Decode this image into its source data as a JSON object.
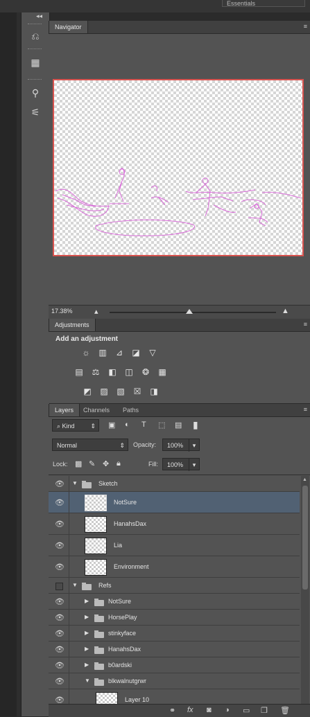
{
  "workspace": {
    "label": "Essentials"
  },
  "tools": {
    "history_icon": "history-icon",
    "properties_icon": "3d-icon",
    "brush_icon": "brush-presets-icon",
    "adjust_icon": "adjustments-tool-icon"
  },
  "navigator": {
    "tab": "Navigator",
    "zoom": "17.38%",
    "zoom_slider_fraction": 0.48
  },
  "adjustments": {
    "tab": "Adjustments",
    "title": "Add an adjustment"
  },
  "layers": {
    "tabs": [
      "Layers",
      "Channels",
      "Paths"
    ],
    "filter_kind": "Kind",
    "blend_mode": "Normal",
    "opacity_label": "Opacity:",
    "opacity_value": "100%",
    "lock_label": "Lock:",
    "fill_label": "Fill:",
    "fill_value": "100%",
    "rows": [
      {
        "name": "Sketch",
        "type": "group",
        "visible": true,
        "expanded": true,
        "indent": 0
      },
      {
        "name": "NotSure",
        "type": "layer",
        "visible": true,
        "selected": true,
        "indent": 1
      },
      {
        "name": "HanahsDax",
        "type": "layer",
        "visible": true,
        "indent": 1
      },
      {
        "name": "Lia",
        "type": "layer",
        "visible": true,
        "indent": 1
      },
      {
        "name": "Environment",
        "type": "layer",
        "visible": true,
        "indent": 1
      },
      {
        "name": "Refs",
        "type": "group",
        "visible": false,
        "expanded": true,
        "indent": 0
      },
      {
        "name": "NotSure",
        "type": "group",
        "visible": true,
        "expanded": false,
        "indent": 1
      },
      {
        "name": "HorsePlay",
        "type": "group",
        "visible": true,
        "expanded": false,
        "indent": 1
      },
      {
        "name": "stinkyface",
        "type": "group",
        "visible": true,
        "expanded": false,
        "indent": 1
      },
      {
        "name": "HanahsDax",
        "type": "group",
        "visible": true,
        "expanded": false,
        "indent": 1
      },
      {
        "name": "b0ardski",
        "type": "group",
        "visible": true,
        "expanded": false,
        "indent": 1
      },
      {
        "name": "blkwalnutgrwr",
        "type": "group",
        "visible": true,
        "expanded": true,
        "indent": 1
      },
      {
        "name": "Layer 10",
        "type": "layer",
        "visible": true,
        "indent": 2
      }
    ]
  },
  "colors": {
    "panel": "#535353",
    "selected_row": "#516173",
    "sketch_stroke": "#e07de0",
    "thumb_border": "#d9534f"
  }
}
